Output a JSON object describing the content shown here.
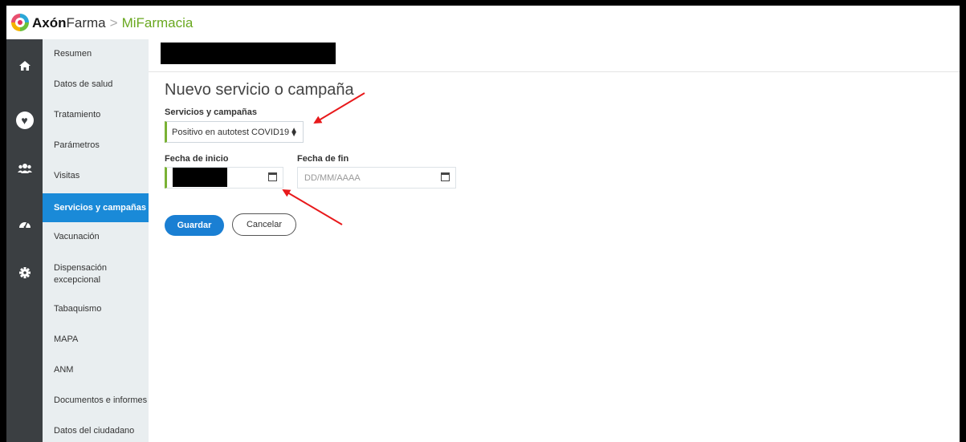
{
  "app": {
    "brand_part1": "Axón",
    "brand_part2": "Farma",
    "separator": ">",
    "product_prefix": "Mi",
    "product_suffix": "Farmacia"
  },
  "rail": {
    "icons": [
      "home-icon",
      "heart-icon",
      "users-icon",
      "dashboard-icon",
      "gear-icon"
    ]
  },
  "sidebar": {
    "items": [
      {
        "label": "Resumen"
      },
      {
        "label": "Datos de salud"
      },
      {
        "label": "Tratamiento"
      },
      {
        "label": "Parámetros"
      },
      {
        "label": "Visitas"
      },
      {
        "label": "Servicios y campañas",
        "active": true
      },
      {
        "label": "Vacunación"
      },
      {
        "label": "Dispensación excepcional"
      },
      {
        "label": "Tabaquismo"
      },
      {
        "label": "MAPA"
      },
      {
        "label": "ANM"
      },
      {
        "label": "Documentos e informes"
      },
      {
        "label": "Datos del ciudadano"
      }
    ]
  },
  "main": {
    "title": "Nuevo servicio o campaña",
    "service_label": "Servicios y campañas",
    "service_value": "Positivo en autotest COVID19",
    "start_label": "Fecha de inicio",
    "end_label": "Fecha de fin",
    "end_placeholder": "DD/MM/AAAA",
    "save_label": "Guardar",
    "cancel_label": "Cancelar"
  },
  "colors": {
    "accent_blue": "#1a7fd3",
    "accent_green": "#7ab234",
    "rail_bg": "#3b3f42",
    "menu_bg": "#e9eef0",
    "annotation_red": "#e8191b"
  }
}
